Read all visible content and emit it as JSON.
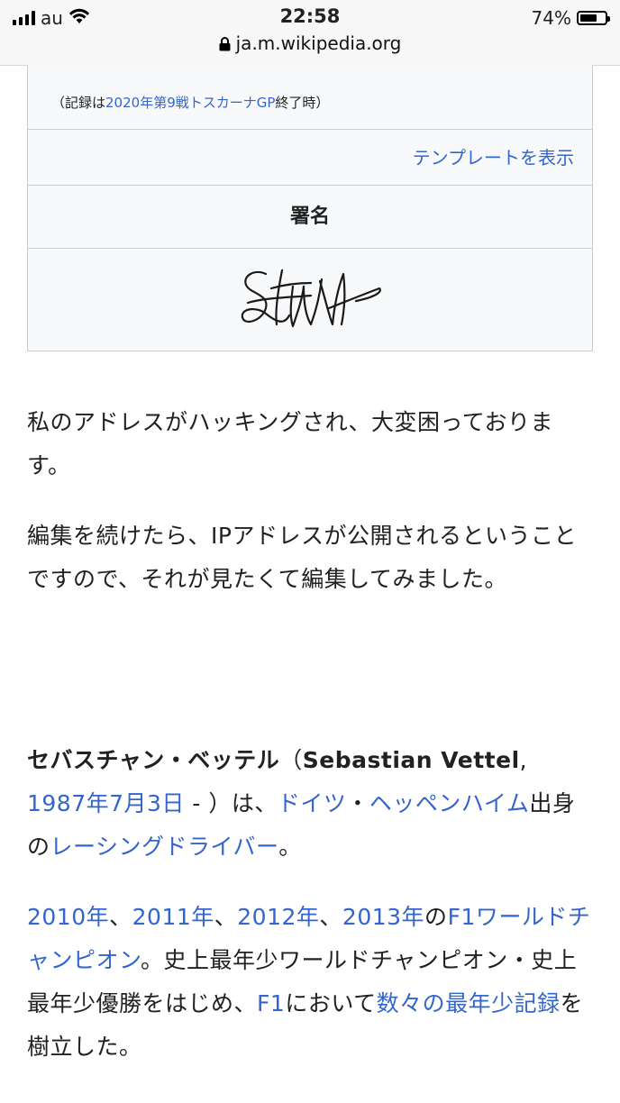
{
  "status_bar": {
    "carrier": "au",
    "time": "22:58",
    "battery": "74%",
    "battery_level": 0.74,
    "url": "ja.m.wikipedia.org"
  },
  "infobox": {
    "note_prefix": "（記録は",
    "note_link": "2020年第9戦トスカーナGP",
    "note_suffix": "終了時）",
    "template_link": "テンプレートを表示",
    "signature_heading": "署名"
  },
  "paragraphs": {
    "p1": "私のアドレスがハッキングされ、大変困っております。",
    "p2": "編集を続けたら、IPアドレスが公開されるということですので、それが見たくて編集してみました。",
    "p3": {
      "name_ja": "セバスチャン・ベッテル",
      "open_paren": "（",
      "name_en": "Sebastian Vettel",
      "comma": ", ",
      "birth_link": "1987年7月3日",
      "dash": " - ）は、",
      "place_link1": "ドイツ",
      "sep": "・",
      "place_link2": "ヘッペンハイム",
      "mid": "出身の",
      "job_link": "レーシングドライバー",
      "end": "。"
    },
    "p4": {
      "y2010": "2010年",
      "c1": "、",
      "y2011": "2011年",
      "c2": "、",
      "y2012": "2012年",
      "c3": "、",
      "y2013": "2013年",
      "no": "の",
      "champ_link": "F1ワールドチャンピオン",
      "text1": "。史上最年少ワールドチャンピオン・史上最年少優勝をはじめ、",
      "f1_link": "F1",
      "text2": "において",
      "records_link": "数々の最年少記録",
      "text3": "を樹立した。"
    }
  }
}
